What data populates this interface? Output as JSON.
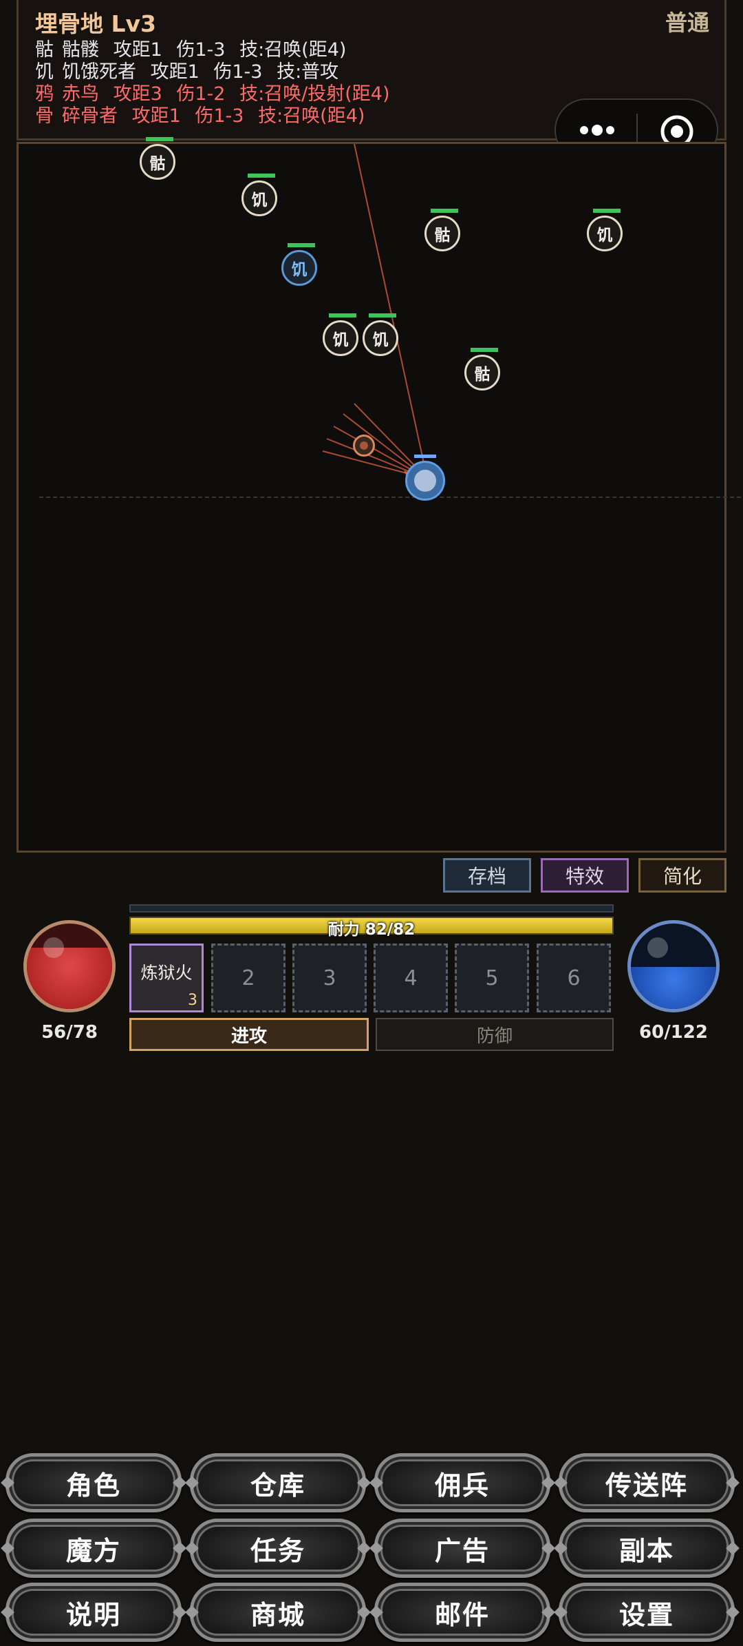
{
  "zone": {
    "title": "埋骨地 Lv3",
    "difficulty": "普通"
  },
  "enemy_legend": [
    {
      "abbr": "骷",
      "name": "骷髅",
      "range": "攻距1",
      "damage": "伤1-3",
      "skill": "技:召唤(距4)",
      "elite": false
    },
    {
      "abbr": "饥",
      "name": "饥饿死者",
      "range": "攻距1",
      "damage": "伤1-3",
      "skill": "技:普攻",
      "elite": false
    },
    {
      "abbr": "鸦",
      "name": "赤鸟",
      "range": "攻距3",
      "damage": "伤1-2",
      "skill": "技:召唤/投射(距4)",
      "elite": true
    },
    {
      "abbr": "骨",
      "name": "碎骨者",
      "range": "攻距1",
      "damage": "伤1-3",
      "skill": "技:召唤(距4)",
      "elite": true
    }
  ],
  "capsule": {
    "more_icon": "more-dots-icon",
    "close_icon": "target-circle-icon"
  },
  "units": [
    {
      "label": "骷",
      "variant": "normal"
    },
    {
      "label": "饥",
      "variant": "normal"
    },
    {
      "label": "骷",
      "variant": "normal"
    },
    {
      "label": "饥",
      "variant": "normal"
    },
    {
      "label": "饥",
      "variant": "elite"
    },
    {
      "label": "饥",
      "variant": "normal"
    },
    {
      "label": "饥",
      "variant": "normal"
    },
    {
      "label": "骷",
      "variant": "normal"
    }
  ],
  "toggles": {
    "save": "存档",
    "effects": "特效",
    "simplify": "简化"
  },
  "player": {
    "hp": {
      "text": "56/78",
      "fraction": 0.718
    },
    "mp": {
      "text": "60/122",
      "fraction": 0.492
    },
    "stamina": {
      "text": "耐力 82/82",
      "fraction": 1.0
    }
  },
  "skills": {
    "slot1": {
      "name": "炼狱火",
      "count": "3"
    },
    "slot2": "2",
    "slot3": "3",
    "slot4": "4",
    "slot5": "5",
    "slot6": "6"
  },
  "modes": {
    "attack": "进攻",
    "defend": "防御",
    "active": "attack"
  },
  "menu": {
    "row1": [
      "角色",
      "仓库",
      "佣兵",
      "传送阵"
    ],
    "row2": [
      "魔方",
      "任务",
      "广告",
      "副本"
    ],
    "row3": [
      "说明",
      "商城",
      "邮件",
      "设置"
    ]
  },
  "colors": {
    "elite_text": "#ff6a6a",
    "title_text": "#f2c79a",
    "hp_bar": "#3ec45a",
    "accent_attack": "#d4a460"
  }
}
